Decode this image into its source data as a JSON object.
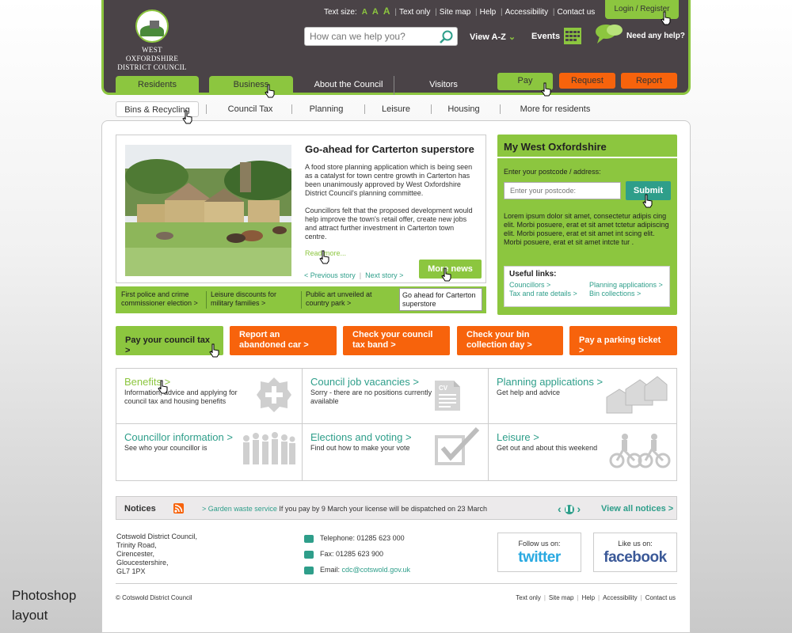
{
  "header": {
    "logo_line1": "WEST OXFORDSHIRE",
    "logo_line2": "DISTRICT COUNCIL",
    "text_size_label": "Text size:",
    "text_size_options": [
      "A",
      "A",
      "A"
    ],
    "top_links": [
      "Text only",
      "Site map",
      "Help",
      "Accessibility",
      "Contact us"
    ],
    "login_label": "Login / Register",
    "search_placeholder": "How can we help you?",
    "view_az": "View A-Z",
    "events": "Events",
    "need_help": "Need any help?"
  },
  "nav": {
    "tabs": [
      "Residents",
      "Business",
      "About the Council",
      "Visitors"
    ],
    "pay": "Pay",
    "request": "Request",
    "report": "Report"
  },
  "subnav": [
    "Bins & Recycling",
    "Council Tax",
    "Planning",
    "Leisure",
    "Housing",
    "More for residents"
  ],
  "news": {
    "title": "Go-ahead for Carterton superstore",
    "para1": "A food store planning application which is being seen as a catalyst for town centre growth in Carterton has been unanimously approved by West Oxfordshire District Council's planning committee.",
    "para2": "Councillors felt that the proposed development would help improve the town's retail offer, create new jobs and attract further investment in Carterton town centre.",
    "read_more": "Read more...",
    "prev": "< Previous story",
    "next": "Next story >",
    "more_news": "More news",
    "strip": [
      "First police and crime commissioner election >",
      "Leisure discounts for military families >",
      "Public art unveiled at country park >",
      "Go ahead for Carterton superstore"
    ]
  },
  "myox": {
    "title": "My West Oxfordshire",
    "postcode_label": "Enter your postcode / address:",
    "postcode_placeholder": "Enter your postcode:",
    "submit": "Submit",
    "lorem": "Lorem ipsum dolor sit amet, consectetur adipis cing elit. Morbi posuere, erat et  sit amet tctetur adipiscing elit. Morbi posuere, erat et  sit amet int scing elit. Morbi posuere, erat et  sit amet intcte tur .",
    "useful_title": "Useful links:",
    "useful_links": [
      "Councillors >",
      "Tax and rate details >",
      "Planning applications >",
      "Bin collections >"
    ]
  },
  "quick_buttons": [
    "Pay your council tax >",
    "Report an abandoned car >",
    "Check your council tax band >",
    "Check your bin collection day >",
    "Pay a parking ticket >"
  ],
  "services": [
    {
      "title": "Benefits >",
      "desc": "Information, advice and applying for council tax and housing benefits",
      "icon": "plus-icon"
    },
    {
      "title": "Council job vacancies >",
      "desc": "Sorry - there are no positions currently available",
      "icon": "cv-document-icon"
    },
    {
      "title": "Planning applications >",
      "desc": "Get help and advice",
      "icon": "houses-icon"
    },
    {
      "title": "Councillor information >",
      "desc": "See who your councillor is",
      "icon": "people-icon"
    },
    {
      "title": "Elections and voting >",
      "desc": "Find out how to make your vote",
      "icon": "checkbox-icon"
    },
    {
      "title": "Leisure >",
      "desc": "Get out and about this weekend",
      "icon": "cyclists-icon"
    }
  ],
  "notices": {
    "label": "Notices",
    "item_link": "Garden waste service",
    "item_text": "If you pay by 9 March your license will be dispatched on 23 March",
    "view_all": "View all notices >"
  },
  "footer": {
    "address": [
      "Cotswold District Council,",
      "Trinity Road,",
      "Cirencester,",
      "Gloucestershire,",
      "GL7 1PX"
    ],
    "telephone": "Telephone: 01285 623 000",
    "fax": "Fax: 01285 623 900",
    "email_label": "Email:",
    "email": "cdc@cotswold.gov.uk",
    "follow": "Follow us on:",
    "twitter": "twitter",
    "like": "Like us on:",
    "facebook": "facebook",
    "copyright": "© Cotswold District Council",
    "links": [
      "Text only",
      "Site map",
      "Help",
      "Accessibility",
      "Contact us"
    ]
  },
  "annotation": {
    "line1": "Photoshop",
    "line2": "layout"
  },
  "colors": {
    "green": "#8cc63f",
    "orange": "#f7630c",
    "teal": "#2e9e8a",
    "header_bg": "#4a4347"
  }
}
